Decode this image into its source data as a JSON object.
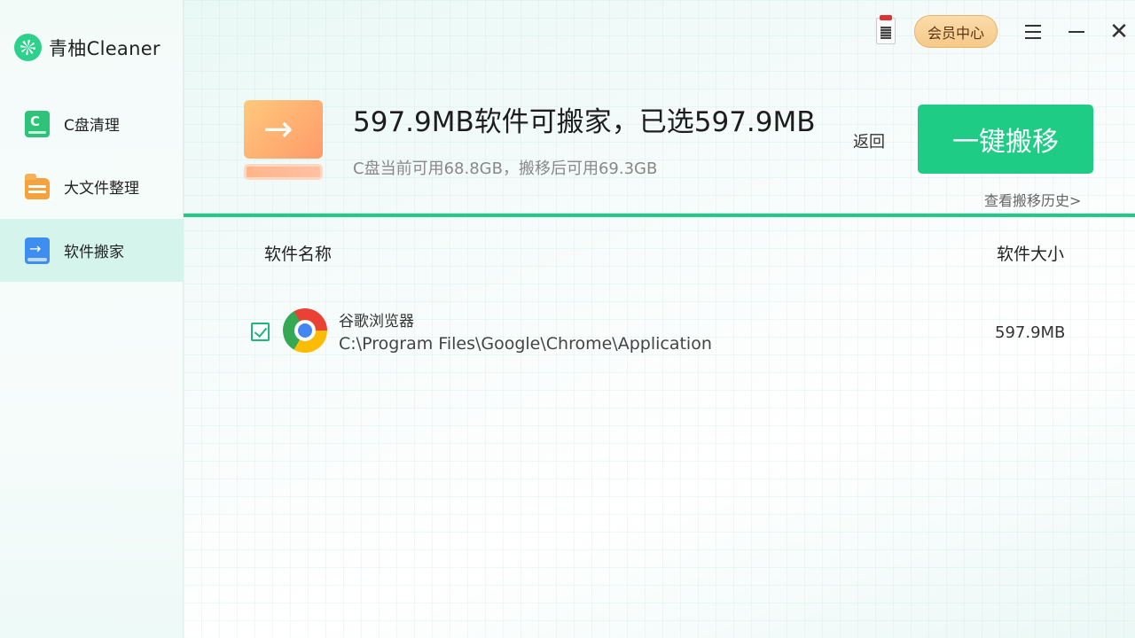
{
  "app": {
    "logo_text": "青柚Cleaner"
  },
  "sidebar": {
    "items": [
      {
        "label": "C盘清理",
        "icon": "c-disk-icon"
      },
      {
        "label": "大文件整理",
        "icon": "folder-icon"
      },
      {
        "label": "软件搬家",
        "icon": "move-software-icon",
        "active": true
      }
    ]
  },
  "titlebar": {
    "vip_label": "会员中心"
  },
  "header": {
    "title": "597.9MB软件可搬家，已选597.9MB",
    "subtitle": "C盘当前可用68.8GB，搬移后可用69.3GB",
    "back_label": "返回",
    "primary_button": "一键搬移",
    "history_link": "查看搬移历史>"
  },
  "table": {
    "columns": [
      "软件名称",
      "软件大小"
    ],
    "rows": [
      {
        "checked": true,
        "name": "谷歌浏览器",
        "path": "C:\\Program Files\\Google\\Chrome\\Application",
        "size": "597.9MB",
        "icon": "chrome-icon"
      }
    ]
  },
  "colors": {
    "accent": "#1fcc86",
    "active_nav_bg": "#d5f5ec",
    "vip_bg": "#f5c98a"
  }
}
